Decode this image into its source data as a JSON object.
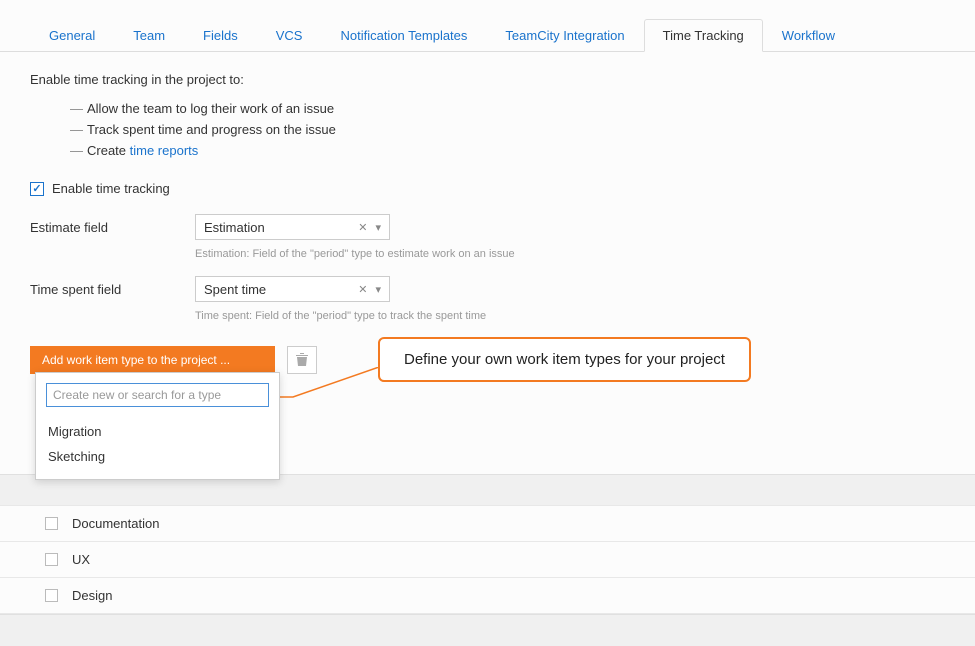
{
  "tabs": [
    {
      "label": "General",
      "active": false
    },
    {
      "label": "Team",
      "active": false
    },
    {
      "label": "Fields",
      "active": false
    },
    {
      "label": "VCS",
      "active": false
    },
    {
      "label": "Notification Templates",
      "active": false
    },
    {
      "label": "TeamCity Integration",
      "active": false
    },
    {
      "label": "Time Tracking",
      "active": true
    },
    {
      "label": "Workflow",
      "active": false
    }
  ],
  "intro": "Enable time tracking in the project to:",
  "bullets": [
    {
      "text": "Allow the team to log their work of an issue"
    },
    {
      "text": "Track spent time and progress on the issue"
    },
    {
      "prefix": "Create ",
      "link": "time reports"
    }
  ],
  "enable_checkbox": {
    "label": "Enable time tracking",
    "checked": true
  },
  "estimate": {
    "label": "Estimate field",
    "value": "Estimation",
    "hint": "Estimation: Field of the \"period\" type to estimate work on an issue"
  },
  "timespent": {
    "label": "Time spent field",
    "value": "Spent time",
    "hint": "Time spent: Field of the \"period\" type to track the spent time"
  },
  "add_button": "Add work item type to the project ...",
  "search_placeholder": "Create new or search for a type",
  "dropdown_items": [
    "Migration",
    "Sketching"
  ],
  "list_items": [
    "Documentation",
    "UX",
    "Design"
  ],
  "callout": "Define your own work item types for your project"
}
